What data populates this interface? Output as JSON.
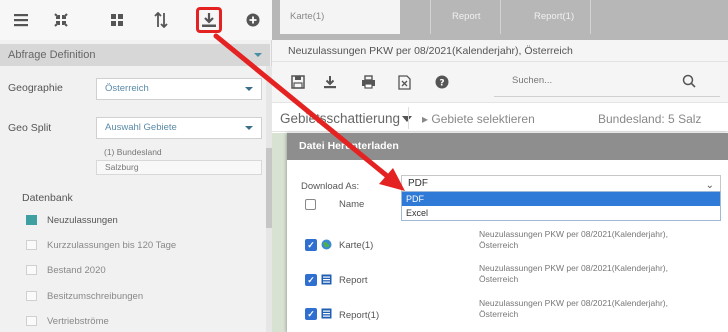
{
  "toolbar": {
    "icons": [
      "menu-icon",
      "collapse-icon",
      "grid-icon",
      "sort-icon",
      "download-icon",
      "add-circle-icon"
    ]
  },
  "left_panel": {
    "section_title": "Abfrage Definition",
    "geographie_label": "Geographie",
    "geographie_value": "Österreich",
    "geo_split_label": "Geo Split",
    "geo_split_value": "Auswahl Gebiete",
    "geo_split_sub1": "(1) Bundesland",
    "geo_split_sub2": "Salzburg",
    "datenbank_label": "Datenbank",
    "datenbank_items": [
      {
        "label": "Neuzulassungen",
        "selected": true
      },
      {
        "label": "Kurzzulassungen bis 120 Tage",
        "selected": false
      },
      {
        "label": "Bestand 2020",
        "selected": false
      },
      {
        "label": "Besitzumschreibungen",
        "selected": false
      },
      {
        "label": "Vertriebströme",
        "selected": false
      }
    ]
  },
  "tabs": [
    {
      "label": "Karte(1)",
      "active": true
    },
    {
      "label": "Report",
      "active": false
    },
    {
      "label": "Report(1)",
      "active": false
    }
  ],
  "main": {
    "title": "Neuzulassungen PKW per 08/2021(Kalenderjahr), Österreich",
    "search_placeholder": "Suchen...",
    "filter_shading": "Gebietsschattierung",
    "filter_select": "Gebiete selektieren",
    "filter_state": "Bundesland: 5 Salz"
  },
  "dialog": {
    "title": "Datei Herunterladen",
    "download_as_label": "Download As:",
    "selected_format": "PDF",
    "options": [
      "PDF",
      "Excel"
    ],
    "name_header": "Name",
    "rows": [
      {
        "name": "Karte(1)",
        "icon": "globe-icon",
        "desc1": "Neuzulassungen PKW per 08/2021(Kalenderjahr),",
        "desc2": "Österreich"
      },
      {
        "name": "Report",
        "icon": "report-icon",
        "desc1": "Neuzulassungen PKW per 08/2021(Kalenderjahr),",
        "desc2": "Österreich"
      },
      {
        "name": "Report(1)",
        "icon": "report-icon",
        "desc1": "Neuzulassungen PKW per 08/2021(Kalenderjahr),",
        "desc2": "Österreich"
      }
    ]
  },
  "colors": {
    "accent_teal": "#3fa0a2",
    "highlight_red": "#e52222",
    "select_blue": "#2f7ad6",
    "checkbox_blue": "#2f6fd0"
  }
}
